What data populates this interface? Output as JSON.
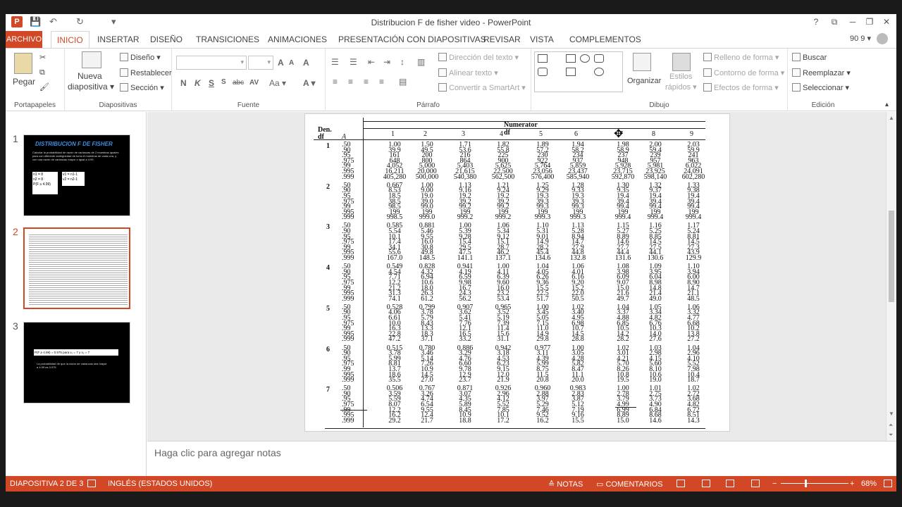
{
  "app": {
    "window_title": "Distribucion F de fisher video - PowerPoint",
    "file_badge": "P"
  },
  "qat": {
    "save": "💾",
    "undo": "↶",
    "redo": "↻",
    "customize": "▾"
  },
  "window_controls": {
    "help": "?",
    "ribbon_options": "⧉",
    "minimize": "─",
    "restore": "❐",
    "close": "✕"
  },
  "tabs": {
    "file": "ARCHIVO",
    "items": [
      "INICIO",
      "INSERTAR",
      "DISEÑO",
      "TRANSICIONES",
      "ANIMACIONES",
      "PRESENTACIÓN CON DIAPOSITIVAS",
      "REVISAR",
      "VISTA",
      "COMPLEMENTOS"
    ],
    "active": "INICIO",
    "user": "90 9 ▾"
  },
  "ribbon": {
    "portapapeles": {
      "label": "Portapapeles",
      "paste": "Pegar"
    },
    "diapositivas": {
      "label": "Diapositivas",
      "new_slide": "Nueva",
      "new_slide2": "diapositiva ▾",
      "layout": "Diseño ▾",
      "reset": "Restablecer",
      "section": "Sección ▾"
    },
    "fuente": {
      "label": "Fuente",
      "bold": "N",
      "italic": "K",
      "underline": "S",
      "strike": "abc",
      "spacing": "AV",
      "case": "Aa ▾",
      "color": "A ▾",
      "grow": "A",
      "shrink": "A",
      "clear": "A"
    },
    "parrafo": {
      "label": "Párrafo",
      "text_direction": "Dirección del texto ▾",
      "align_text": "Alinear texto ▾",
      "smartart": "Convertir a SmartArt ▾"
    },
    "dibujo": {
      "label": "Dibujo",
      "arrange": "Organizar",
      "quick_styles": "Estilos",
      "quick_styles2": "rápidos ▾",
      "shape_fill": "Relleno de forma ▾",
      "shape_outline": "Contorno de forma ▾",
      "shape_effects": "Efectos de forma ▾"
    },
    "edicion": {
      "label": "Edición",
      "find": "Buscar",
      "replace": "Reemplazar ▾",
      "select": "Seleccionar ▾"
    }
  },
  "thumbnails": [
    {
      "number": "1",
      "title": "DISTRIBUCION F DE FISHER",
      "body": "Calcular la probabilidad de razón de varianzas de 2 muestras iguales para con diferente ambigüedad de tomo 8 muestras de cada una, y con una razón de varianzas mayor o igual a 4.99.",
      "box1": "n1 = 8\nn2 = 8\nP(F ≥ 4.99)",
      "box2": "v1 = n1-1\nv2 = n2-1"
    },
    {
      "number": "2"
    },
    {
      "number": "3",
      "box": "P(F ≥ 4.99) = 0.975  para  v₁ = 7 y v₂ = 7",
      "body": "La probabilidad de que la razón de varianzas sea mayor a 4.99 es 0.975"
    }
  ],
  "table": {
    "numerator_label": "Numerator df",
    "den_label": "Den.",
    "df_label": "df",
    "alpha_label": "A",
    "col_headers": [
      "1",
      "2",
      "3",
      "4",
      "5",
      "6",
      "7",
      "8",
      "9"
    ],
    "blocks": [
      {
        "df": "1",
        "p": [
          ".50",
          ".90",
          ".95",
          ".975",
          ".99",
          ".995",
          ".999"
        ],
        "cols": [
          [
            "1.00",
            "39.9",
            "161",
            "648",
            "4,052",
            "16,211",
            "405,280"
          ],
          [
            "1.50",
            "49.5",
            "200",
            "800",
            "5,000",
            "20,000",
            "500,000"
          ],
          [
            "1.71",
            "53.6",
            "216",
            "864",
            "5,403",
            "21,615",
            "540,380"
          ],
          [
            "1.82",
            "55.8",
            "225",
            "900",
            "5,625",
            "22,500",
            "562,500"
          ],
          [
            "1.89",
            "57.2",
            "230",
            "922",
            "5,764",
            "23,056",
            "576,400"
          ],
          [
            "1.94",
            "58.2",
            "234",
            "937",
            "5,859",
            "23,437",
            "585,940"
          ],
          [
            "1.98",
            "58.9",
            "237",
            "948",
            "5,928",
            "23,715",
            "592,870"
          ],
          [
            "2.00",
            "59.4",
            "239",
            "957",
            "5,981",
            "23,925",
            "598,140"
          ],
          [
            "2.03",
            "59.9",
            "241",
            "963",
            "6,022",
            "24,091",
            "602,280"
          ]
        ]
      },
      {
        "df": "2",
        "p": [
          ".50",
          ".90",
          ".95",
          ".975",
          ".99",
          ".995",
          ".999"
        ],
        "cols": [
          [
            "0.667",
            "8.53",
            "18.5",
            "38.5",
            "98.5",
            "199",
            "998.5"
          ],
          [
            "1.00",
            "9.00",
            "19.0",
            "39.0",
            "99.0",
            "199",
            "999.0"
          ],
          [
            "1.13",
            "9.16",
            "19.2",
            "39.2",
            "99.2",
            "199",
            "999.2"
          ],
          [
            "1.21",
            "9.24",
            "19.2",
            "39.2",
            "99.2",
            "199",
            "999.2"
          ],
          [
            "1.25",
            "9.29",
            "19.3",
            "39.3",
            "99.3",
            "199",
            "999.3"
          ],
          [
            "1.28",
            "9.33",
            "19.3",
            "39.3",
            "99.3",
            "199",
            "999.3"
          ],
          [
            "1.30",
            "9.35",
            "19.4",
            "39.4",
            "99.4",
            "199",
            "999.4"
          ],
          [
            "1.32",
            "9.37",
            "19.4",
            "39.4",
            "99.4",
            "199",
            "999.4"
          ],
          [
            "1.33",
            "9.38",
            "19.4",
            "39.4",
            "99.4",
            "199",
            "999.4"
          ]
        ]
      },
      {
        "df": "3",
        "p": [
          ".50",
          ".90",
          ".95",
          ".975",
          ".99",
          ".995",
          ".999"
        ],
        "cols": [
          [
            "0.585",
            "5.54",
            "10.1",
            "17.4",
            "34.1",
            "55.6",
            "167.0"
          ],
          [
            "0.881",
            "5.46",
            "9.55",
            "16.0",
            "30.8",
            "49.8",
            "148.5"
          ],
          [
            "1.00",
            "5.39",
            "9.28",
            "15.4",
            "29.5",
            "47.5",
            "141.1"
          ],
          [
            "1.06",
            "5.34",
            "9.12",
            "15.1",
            "28.7",
            "46.2",
            "137.1"
          ],
          [
            "1.10",
            "5.31",
            "9.01",
            "14.9",
            "28.2",
            "45.4",
            "134.6"
          ],
          [
            "1.13",
            "5.28",
            "8.94",
            "14.7",
            "27.9",
            "44.8",
            "132.8"
          ],
          [
            "1.15",
            "5.27",
            "8.89",
            "14.6",
            "27.7",
            "44.4",
            "131.6"
          ],
          [
            "1.16",
            "5.25",
            "8.85",
            "14.5",
            "27.5",
            "44.1",
            "130.6"
          ],
          [
            "1.17",
            "5.24",
            "8.81",
            "14.5",
            "27.3",
            "43.9",
            "129.9"
          ]
        ]
      },
      {
        "df": "4",
        "p": [
          ".50",
          ".90",
          ".95",
          ".975",
          ".99",
          ".995",
          ".999"
        ],
        "cols": [
          [
            "0.549",
            "4.54",
            "7.71",
            "12.2",
            "21.2",
            "31.3",
            "74.1"
          ],
          [
            "0.828",
            "4.32",
            "6.94",
            "10.6",
            "18.0",
            "26.3",
            "61.2"
          ],
          [
            "0.941",
            "4.19",
            "6.59",
            "9.98",
            "16.7",
            "24.3",
            "56.2"
          ],
          [
            "1.00",
            "4.11",
            "6.39",
            "9.60",
            "16.0",
            "23.2",
            "53.4"
          ],
          [
            "1.04",
            "4.05",
            "6.26",
            "9.36",
            "15.5",
            "22.5",
            "51.7"
          ],
          [
            "1.06",
            "4.01",
            "6.16",
            "9.20",
            "15.2",
            "22.0",
            "50.5"
          ],
          [
            "1.08",
            "3.98",
            "6.09",
            "9.07",
            "15.0",
            "21.6",
            "49.7"
          ],
          [
            "1.09",
            "3.95",
            "6.04",
            "8.98",
            "14.8",
            "21.4",
            "49.0"
          ],
          [
            "1.10",
            "3.94",
            "6.00",
            "8.90",
            "14.7",
            "21.1",
            "48.5"
          ]
        ]
      },
      {
        "df": "5",
        "p": [
          ".50",
          ".90",
          ".95",
          ".975",
          ".99",
          ".995",
          ".999"
        ],
        "cols": [
          [
            "0.528",
            "4.06",
            "6.61",
            "10.0",
            "16.3",
            "22.8",
            "47.2"
          ],
          [
            "0.799",
            "3.78",
            "5.79",
            "8.43",
            "13.3",
            "18.3",
            "37.1"
          ],
          [
            "0.907",
            "3.62",
            "5.41",
            "7.76",
            "12.1",
            "16.5",
            "33.2"
          ],
          [
            "0.965",
            "3.52",
            "5.19",
            "7.39",
            "11.4",
            "15.6",
            "31.1"
          ],
          [
            "1.00",
            "3.45",
            "5.05",
            "7.15",
            "11.0",
            "14.9",
            "29.8"
          ],
          [
            "1.02",
            "3.40",
            "4.95",
            "6.98",
            "10.7",
            "14.5",
            "28.8"
          ],
          [
            "1.04",
            "3.37",
            "4.88",
            "6.85",
            "10.5",
            "14.2",
            "28.2"
          ],
          [
            "1.05",
            "3.34",
            "4.82",
            "6.76",
            "10.3",
            "14.0",
            "27.6"
          ],
          [
            "1.06",
            "3.32",
            "4.77",
            "6.68",
            "10.2",
            "13.8",
            "27.2"
          ]
        ]
      },
      {
        "df": "6",
        "p": [
          ".50",
          ".90",
          ".95",
          ".975",
          ".99",
          ".995",
          ".999"
        ],
        "cols": [
          [
            "0.515",
            "3.78",
            "5.99",
            "8.81",
            "13.7",
            "18.6",
            "35.5"
          ],
          [
            "0.780",
            "3.46",
            "5.14",
            "7.26",
            "10.9",
            "14.5",
            "27.0"
          ],
          [
            "0.886",
            "3.29",
            "4.76",
            "6.60",
            "9.78",
            "12.9",
            "23.7"
          ],
          [
            "0.942",
            "3.18",
            "4.53",
            "6.23",
            "9.15",
            "12.0",
            "21.9"
          ],
          [
            "0.977",
            "3.11",
            "4.39",
            "5.99",
            "8.75",
            "11.5",
            "20.8"
          ],
          [
            "1.00",
            "3.05",
            "4.28",
            "5.82",
            "8.47",
            "11.1",
            "20.0"
          ],
          [
            "1.02",
            "3.01",
            "4.21",
            "5.70",
            "8.26",
            "10.8",
            "19.5"
          ],
          [
            "1.03",
            "2.98",
            "4.15",
            "5.60",
            "8.10",
            "10.6",
            "19.0"
          ],
          [
            "1.04",
            "2.96",
            "4.10",
            "5.52",
            "7.98",
            "10.4",
            "18.7"
          ]
        ]
      },
      {
        "df": "7",
        "p": [
          ".50",
          ".90",
          ".95",
          ".975",
          ".99",
          ".995",
          ".999"
        ],
        "cols": [
          [
            "0.506",
            "3.59",
            "5.59",
            "8.07",
            "12.2",
            "16.2",
            "29.2"
          ],
          [
            "0.767",
            "3.26",
            "4.74",
            "6.54",
            "9.55",
            "12.4",
            "21.7"
          ],
          [
            "0.871",
            "3.07",
            "4.35",
            "5.89",
            "8.45",
            "10.9",
            "18.8"
          ],
          [
            "0.926",
            "2.96",
            "4.12",
            "5.52",
            "7.85",
            "10.1",
            "17.2"
          ],
          [
            "0.960",
            "2.88",
            "3.97",
            "5.29",
            "7.46",
            "9.52",
            "16.2"
          ],
          [
            "0.983",
            "2.83",
            "3.87",
            "5.12",
            "7.19",
            "9.16",
            "15.5"
          ],
          [
            "1.00",
            "2.78",
            "3.79",
            "4.99",
            "6.99",
            "8.89",
            "15.0"
          ],
          [
            "1.01",
            "2.75",
            "3.73",
            "4.90",
            "6.84",
            "8.68",
            "14.6"
          ],
          [
            "1.02",
            "2.72",
            "3.68",
            "4.82",
            "6.72",
            "8.51",
            "14.3"
          ]
        ]
      }
    ]
  },
  "notes": {
    "placeholder": "Haga clic para agregar notas"
  },
  "status": {
    "slide_info": "DIAPOSITIVA 2 DE 3",
    "language": "INGLÉS (ESTADOS UNIDOS)",
    "notes": "NOTAS",
    "comments": "COMENTARIOS",
    "zoom_minus": "−",
    "zoom_plus": "+",
    "zoom": "68%",
    "zoom_level": 0.68
  },
  "colors": {
    "accent": "#d24726",
    "status_bar": "#d24726"
  }
}
